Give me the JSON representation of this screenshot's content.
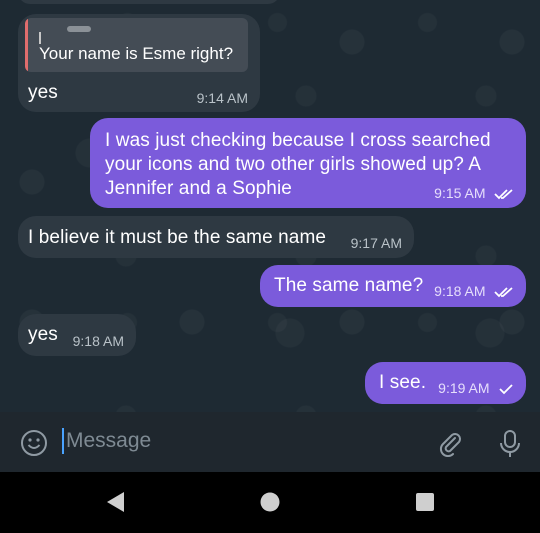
{
  "messages": [
    {
      "id": "m1",
      "direction": "incoming",
      "reply_preview": "Your name is Esme right?",
      "text": "yes",
      "time": "9:14 AM"
    },
    {
      "id": "m2",
      "direction": "outgoing",
      "lines": [
        "I was just checking because I cross searched",
        "your icons and two other girls showed up? A",
        "Jennifer and a Sophie"
      ],
      "time": "9:15 AM",
      "status": "read"
    },
    {
      "id": "m3",
      "direction": "incoming",
      "text": "I believe it must be the same name",
      "time": "9:17 AM"
    },
    {
      "id": "m4",
      "direction": "outgoing",
      "text": "The same name?",
      "time": "9:18 AM",
      "status": "read"
    },
    {
      "id": "m5",
      "direction": "incoming",
      "text": "yes",
      "time": "9:18 AM"
    },
    {
      "id": "m6",
      "direction": "outgoing",
      "text": "I see.",
      "time": "9:19 AM",
      "status": "sent"
    }
  ],
  "composer": {
    "placeholder": "Message",
    "emoji_icon": "emoji-icon",
    "attach_icon": "paperclip-icon",
    "mic_icon": "microphone-icon"
  },
  "navigation": {
    "back_icon": "back-triangle-icon",
    "home_icon": "home-circle-icon",
    "recents_icon": "recents-square-icon"
  },
  "colors": {
    "chat_background": "#1e2a33",
    "incoming_bubble": "#2e3942",
    "outgoing_bubble": "#7b5bdb",
    "reply_accent": "#e06d6d",
    "cursor": "#4aa3ff"
  }
}
